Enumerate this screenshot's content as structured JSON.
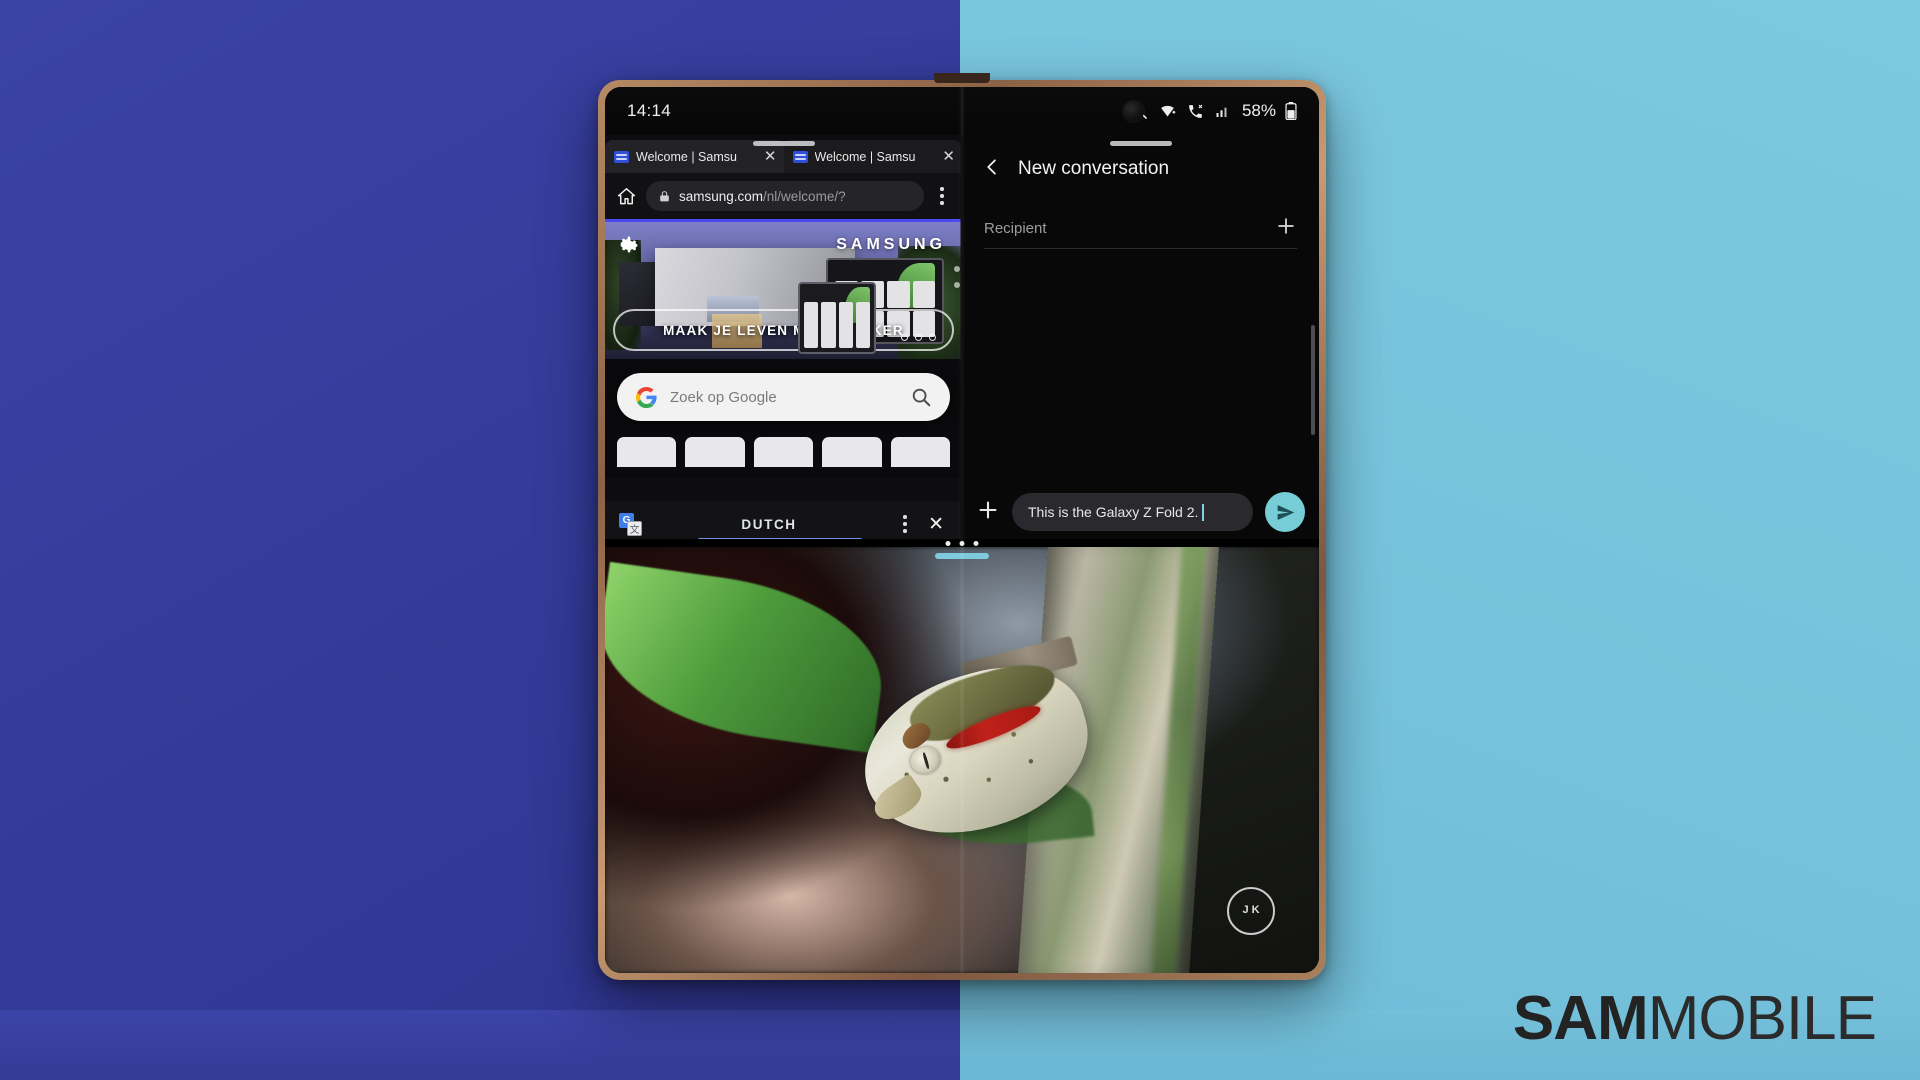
{
  "scene": {
    "background_left_color": "#343c9b",
    "background_right_color": "#76c2dc",
    "device_frame_color": "#a8805c"
  },
  "watermark": {
    "bold": "SAM",
    "light": "MOBILE"
  },
  "status_bar": {
    "clock": "14:14",
    "battery_percent": "58%",
    "icons": [
      "mute-icon",
      "wifi-icon",
      "call-icon",
      "signal-icon",
      "battery-icon"
    ]
  },
  "browser": {
    "tabs": [
      {
        "title": "Welcome | Samsu",
        "close_label": "✕"
      },
      {
        "title": "Welcome | Samsu",
        "close_label": "✕"
      }
    ],
    "url_secure_host": "samsung.com",
    "url_path": "/nl/welcome/?",
    "home_icon": "home-icon",
    "lock_icon": "lock-icon",
    "menu_icon": "kebab-menu-icon"
  },
  "webpage": {
    "brand": "SAMSUNG",
    "hero_caption": "MAAK JE LEVEN MAKKELIJKER",
    "gear_icon": "gear-icon",
    "search_placeholder": "Zoek op Google",
    "google_logo": "google-g-icon",
    "search_icon": "search-icon",
    "shortcut_count": 5
  },
  "translate_bar": {
    "app_icon": "google-translate-icon",
    "icon_letter_source": "G",
    "icon_letter_target": "文",
    "language": "DUTCH",
    "menu_icon": "kebab-menu-icon",
    "close_label": "✕"
  },
  "messages": {
    "back_icon": "back-arrow-icon",
    "title": "New conversation",
    "recipient_label": "Recipient",
    "add_recipient_icon": "plus-icon",
    "attach_icon": "plus-icon",
    "compose_text": "This is the Galaxy Z Fold 2.",
    "send_icon": "send-icon",
    "send_button_color": "#76cdd6"
  },
  "wallpaper": {
    "description": "eyelash viper on tree trunk",
    "photographer_mark": "J K"
  },
  "split_view": {
    "handle_icon": "drag-handle-icon",
    "dots_icon": "three-dots-handle-icon",
    "pill_color": "#7ec9dd"
  }
}
